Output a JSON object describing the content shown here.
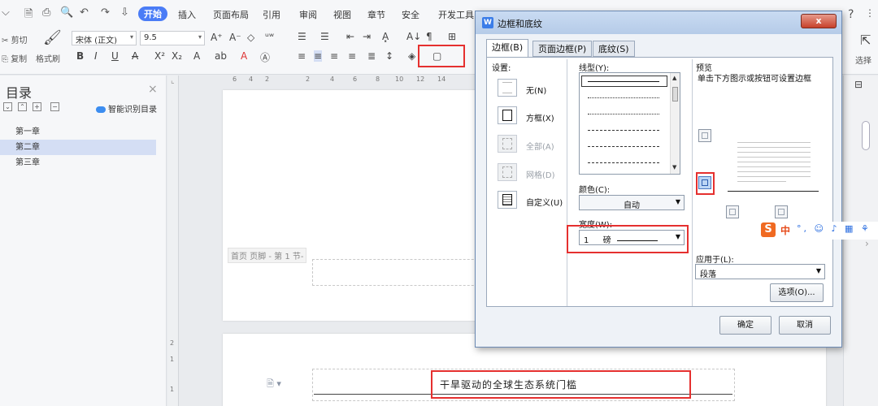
{
  "ribbon": {
    "tabs": [
      "开始",
      "插入",
      "页面布局",
      "引用",
      "审阅",
      "视图",
      "章节",
      "安全",
      "开发工具"
    ],
    "clipboard": {
      "cut": "剪切",
      "copy": "复制",
      "format_painter": "格式刷"
    },
    "font_name": "宋体 (正文)",
    "font_size": "9.5",
    "select_label": "选择",
    "help": "?"
  },
  "toc": {
    "title": "目录",
    "smart_button": "智能识别目录",
    "items": [
      {
        "label": "第一章",
        "selected": false
      },
      {
        "label": "第二章",
        "selected": true
      },
      {
        "label": "第三章",
        "selected": false
      }
    ]
  },
  "document": {
    "footer_label": "首页 页脚 - 第 1 节-",
    "heading": "干旱驱动的全球生态系统门槛",
    "ruler_ticks": [
      "6",
      "4",
      "2",
      "2",
      "4",
      "6",
      "8",
      "10",
      "12",
      "14"
    ],
    "vruler_ticks": [
      "2",
      "1",
      "1"
    ]
  },
  "dialog": {
    "title": "边框和底纹",
    "close": "x",
    "tabs": [
      {
        "label": "边框(B)",
        "active": true
      },
      {
        "label": "页面边框(P)",
        "active": false
      },
      {
        "label": "底纹(S)",
        "active": false
      }
    ],
    "settings_label": "设置:",
    "settings": [
      {
        "label": "无(N)",
        "disabled": false
      },
      {
        "label": "方框(X)",
        "disabled": false
      },
      {
        "label": "全部(A)",
        "disabled": true
      },
      {
        "label": "网格(D)",
        "disabled": true
      },
      {
        "label": "自定义(U)",
        "disabled": false
      }
    ],
    "line_style_label": "线型(Y):",
    "color_label": "颜色(C):",
    "color_value": "自动",
    "width_label": "宽度(W):",
    "width_value": "1",
    "width_unit": "磅",
    "preview_label": "预览",
    "preview_hint": "单击下方图示或按钮可设置边框",
    "apply_label": "应用于(L):",
    "apply_value": "段落",
    "options_button": "选项(O)...",
    "ok_button": "确定",
    "cancel_button": "取消"
  },
  "ime": {
    "logo": "S",
    "mode": "中"
  },
  "colors": {
    "accent": "#4a7cf6",
    "highlight": "#e5302f",
    "selection": "#d4def4"
  }
}
